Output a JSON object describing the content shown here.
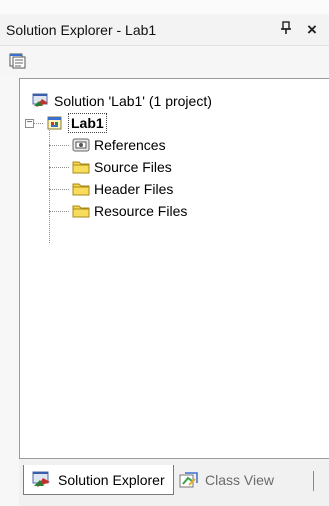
{
  "window": {
    "title": "Solution Explorer - Lab1",
    "pin_glyph": "Ɣ",
    "close_glyph": "×"
  },
  "toolbar": {
    "properties_icon": "properties-icon"
  },
  "tree": {
    "solution_label": "Solution 'Lab1' (1 project)",
    "project_label": "Lab1",
    "project_expander": "−",
    "children": [
      {
        "label": "References",
        "icon": "references-icon"
      },
      {
        "label": "Source Files",
        "icon": "folder-icon"
      },
      {
        "label": "Header Files",
        "icon": "folder-icon"
      },
      {
        "label": "Resource Files",
        "icon": "folder-icon"
      }
    ]
  },
  "tabs": [
    {
      "label": "Solution Explorer",
      "icon": "solution-explorer-icon",
      "active": true
    },
    {
      "label": "Class View",
      "icon": "class-view-icon",
      "active": false
    }
  ],
  "colors": {
    "folder": "#f5d64a",
    "selection_border": "#444444",
    "inactive_tab_text": "#6b6b6b"
  }
}
